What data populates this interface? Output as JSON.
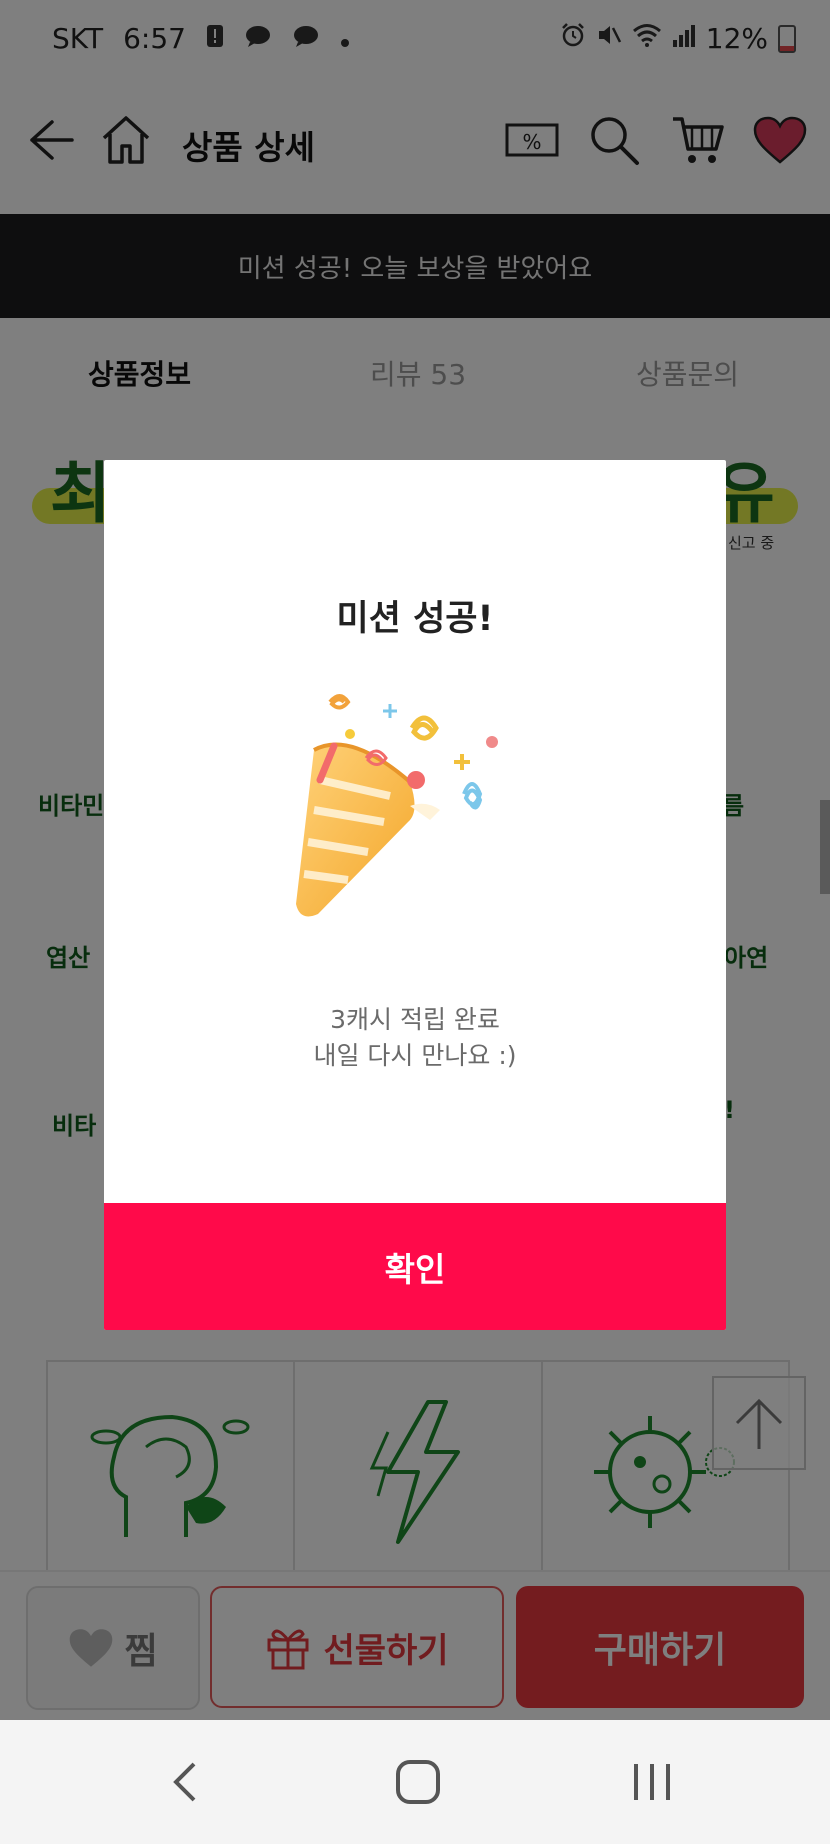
{
  "status_bar": {
    "carrier": "SKT",
    "time": "6:57",
    "battery": "12%",
    "icons": [
      "alert-icon",
      "chat-icon",
      "chat-icon",
      "dot-icon",
      "alarm-icon",
      "mute-icon",
      "wifi-icon",
      "signal-icon",
      "battery-icon"
    ]
  },
  "app_bar": {
    "title": "상품 상세",
    "icons": [
      "back-arrow-icon",
      "home-icon",
      "coupon-icon",
      "search-icon",
      "cart-icon",
      "heart-icon"
    ],
    "coupon_label": "%"
  },
  "banner": {
    "text": "미션 성공! 오늘 보상을 받았어요"
  },
  "tabs": [
    {
      "label": "상품정보",
      "active": true
    },
    {
      "label": "리뷰 53",
      "active": false
    },
    {
      "label": "상품문의",
      "active": false
    }
  ],
  "content": {
    "headline_left": "최",
    "headline_right": "유",
    "report_note": "신고 중",
    "side_texts": [
      "비타민",
      "름",
      "엽산",
      "아연",
      "비타",
      "!"
    ]
  },
  "modal": {
    "title": "미션 성공!",
    "message_line1": "3캐시 적립 완료",
    "message_line2": "내일 다시 만나요 :)",
    "confirm_label": "확인",
    "confirm_color": "#ff0a4a"
  },
  "bottom_bar": {
    "wish_label": "찜",
    "gift_label": "선물하기",
    "buy_label": "구매하기",
    "buy_color": "#e8383f"
  },
  "nav_bar": {
    "icons": [
      "back-nav-icon",
      "home-nav-icon",
      "recents-nav-icon"
    ]
  }
}
